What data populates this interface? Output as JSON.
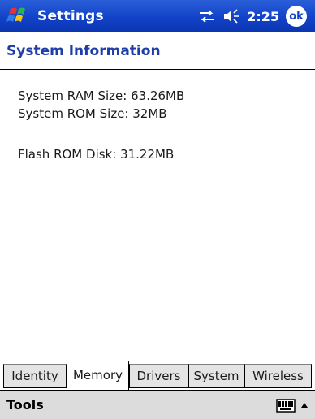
{
  "titlebar": {
    "title": "Settings",
    "time": "2:25",
    "ok_label": "ok",
    "accent": "#1142c8"
  },
  "page": {
    "header": "System Information",
    "header_color": "#1d3ea8"
  },
  "info": {
    "ram": "System RAM Size: 63.26MB",
    "rom": "System ROM Size: 32MB",
    "flash": "Flash ROM Disk: 31.22MB"
  },
  "tabs": [
    {
      "label": "Identity",
      "active": false
    },
    {
      "label": "Memory",
      "active": true
    },
    {
      "label": "Drivers",
      "active": false
    },
    {
      "label": "System",
      "active": false
    },
    {
      "label": "Wireless",
      "active": false
    }
  ],
  "cmdbar": {
    "tools_label": "Tools",
    "icons": [
      "keyboard-icon",
      "up-arrow-icon"
    ]
  }
}
